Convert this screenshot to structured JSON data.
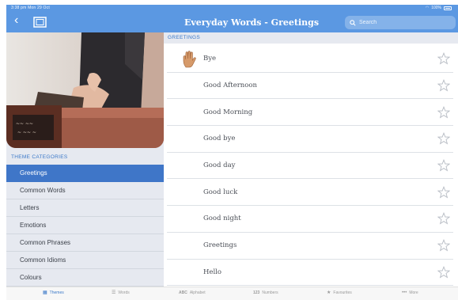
{
  "status": {
    "time": "3:38 pm",
    "date": "Mon 29 Oct",
    "battery": "100%"
  },
  "header": {
    "title": "Everyday Words - Greetings",
    "search_placeholder": "Search"
  },
  "sidebar": {
    "categories_header": "THEME CATEGORIES",
    "items": [
      {
        "label": "Greetings",
        "active": true
      },
      {
        "label": "Common Words"
      },
      {
        "label": "Letters"
      },
      {
        "label": "Emotions"
      },
      {
        "label": "Common Phrases"
      },
      {
        "label": "Common Idioms"
      },
      {
        "label": "Colours"
      }
    ]
  },
  "main": {
    "section_header": "GREETINGS",
    "words": [
      {
        "label": "Bye"
      },
      {
        "label": "Good Afternoon"
      },
      {
        "label": "Good Morning"
      },
      {
        "label": "Good bye"
      },
      {
        "label": "Good day"
      },
      {
        "label": "Good luck"
      },
      {
        "label": "Good night"
      },
      {
        "label": "Greetings"
      },
      {
        "label": "Hello"
      }
    ]
  },
  "tabs": [
    {
      "label": "Themes",
      "icon": "grid-icon",
      "active": true
    },
    {
      "label": "Words",
      "icon": "list-icon"
    },
    {
      "label": "Alphabet",
      "icon": "abc-icon"
    },
    {
      "label": "Numbers",
      "icon": "123-icon"
    },
    {
      "label": "Favourites",
      "icon": "star-icon"
    },
    {
      "label": "More",
      "icon": "more-icon"
    }
  ],
  "colors": {
    "accent": "#5b98e2",
    "selected": "#3f76c8",
    "sidebar_bg": "#e6e9f0"
  }
}
